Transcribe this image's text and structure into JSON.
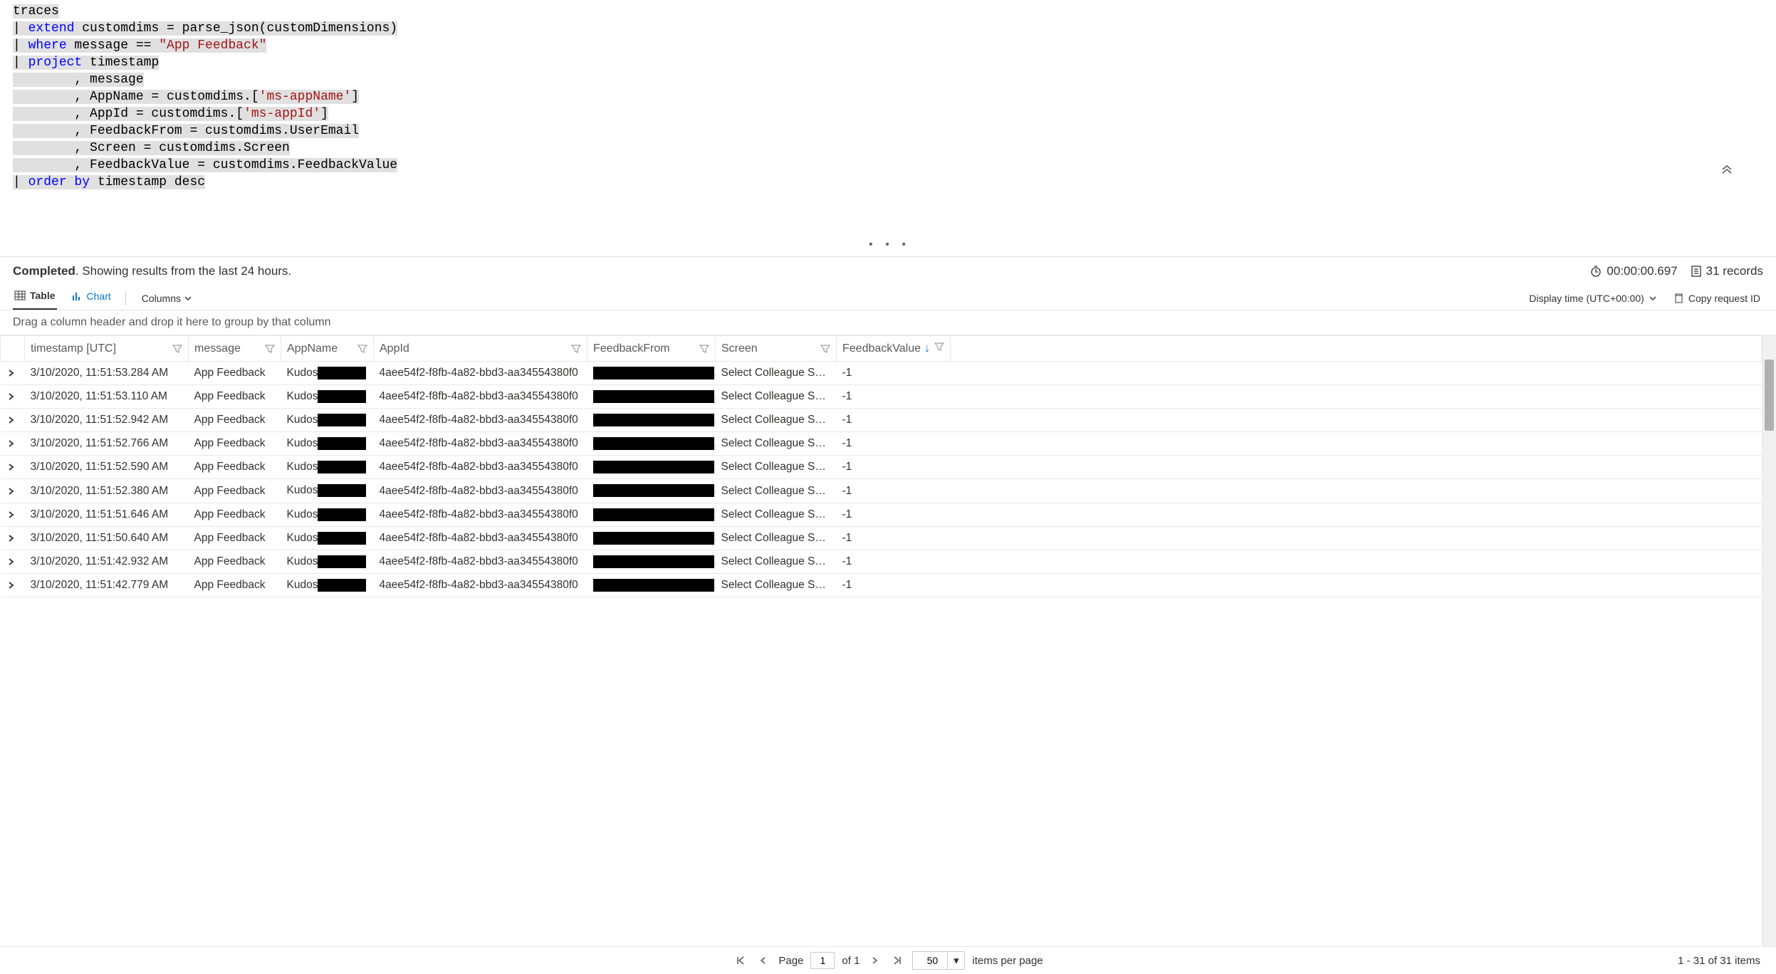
{
  "query": {
    "line1": "traces",
    "extend_kw": "extend",
    "extend_rest": " customdims = parse_json(customDimensions)",
    "where_kw": "where",
    "where_mid": " message == ",
    "where_str": "\"App Feedback\"",
    "project_kw": "project",
    "project_1": " timestamp",
    "project_2": "        , message",
    "project_3": "        , AppName = customdims.[",
    "project_3_str": "'ms-appName'",
    "project_3_end": "]",
    "project_4": "        , AppId = customdims.[",
    "project_4_str": "'ms-appId'",
    "project_4_end": "]",
    "project_5": "        , FeedbackFrom = customdims.UserEmail",
    "project_6": "        , Screen = customdims.Screen",
    "project_7": "        , FeedbackValue = customdims.FeedbackValue",
    "order_kw": "order by",
    "order_rest": " timestamp desc"
  },
  "status": {
    "completed": "Completed",
    "text": ". Showing results from the last 24 hours.",
    "duration": "00:00:00.697",
    "records": "31 records"
  },
  "tabs": {
    "table": "Table",
    "chart": "Chart",
    "columns": "Columns",
    "display_time": "Display time (UTC+00:00)",
    "copy_request": "Copy request ID"
  },
  "group_hint": "Drag a column header and drop it here to group by that column",
  "columns": {
    "timestamp": "timestamp [UTC]",
    "message": "message",
    "appname": "AppName",
    "appid": "AppId",
    "feedbackfrom": "FeedbackFrom",
    "screen": "Screen",
    "feedbackvalue": "FeedbackValue"
  },
  "rows": [
    {
      "ts": "3/10/2020, 11:51:53.284 AM",
      "msg": "App Feedback",
      "app": "Kudos",
      "id": "4aee54f2-f8fb-4a82-bbd3-aa34554380f0",
      "screen": "Select Colleague Screen",
      "fv": "-1"
    },
    {
      "ts": "3/10/2020, 11:51:53.110 AM",
      "msg": "App Feedback",
      "app": "Kudos",
      "id": "4aee54f2-f8fb-4a82-bbd3-aa34554380f0",
      "screen": "Select Colleague Screen",
      "fv": "-1"
    },
    {
      "ts": "3/10/2020, 11:51:52.942 AM",
      "msg": "App Feedback",
      "app": "Kudos",
      "id": "4aee54f2-f8fb-4a82-bbd3-aa34554380f0",
      "screen": "Select Colleague Screen",
      "fv": "-1"
    },
    {
      "ts": "3/10/2020, 11:51:52.766 AM",
      "msg": "App Feedback",
      "app": "Kudos",
      "id": "4aee54f2-f8fb-4a82-bbd3-aa34554380f0",
      "screen": "Select Colleague Screen",
      "fv": "-1"
    },
    {
      "ts": "3/10/2020, 11:51:52.590 AM",
      "msg": "App Feedback",
      "app": "Kudos",
      "id": "4aee54f2-f8fb-4a82-bbd3-aa34554380f0",
      "screen": "Select Colleague Screen",
      "fv": "-1"
    },
    {
      "ts": "3/10/2020, 11:51:52.380 AM",
      "msg": "App Feedback",
      "app": "Kudos",
      "id": "4aee54f2-f8fb-4a82-bbd3-aa34554380f0",
      "screen": "Select Colleague Screen",
      "fv": "-1"
    },
    {
      "ts": "3/10/2020, 11:51:51.646 AM",
      "msg": "App Feedback",
      "app": "Kudos",
      "id": "4aee54f2-f8fb-4a82-bbd3-aa34554380f0",
      "screen": "Select Colleague Screen",
      "fv": "-1"
    },
    {
      "ts": "3/10/2020, 11:51:50.640 AM",
      "msg": "App Feedback",
      "app": "Kudos",
      "id": "4aee54f2-f8fb-4a82-bbd3-aa34554380f0",
      "screen": "Select Colleague Screen",
      "fv": "-1"
    },
    {
      "ts": "3/10/2020, 11:51:42.932 AM",
      "msg": "App Feedback",
      "app": "Kudos",
      "id": "4aee54f2-f8fb-4a82-bbd3-aa34554380f0",
      "screen": "Select Colleague Screen",
      "fv": "-1"
    },
    {
      "ts": "3/10/2020, 11:51:42.779 AM",
      "msg": "App Feedback",
      "app": "Kudos",
      "id": "4aee54f2-f8fb-4a82-bbd3-aa34554380f0",
      "screen": "Select Colleague Screen",
      "fv": "-1"
    }
  ],
  "pager": {
    "page_label": "Page",
    "page": "1",
    "of": "of 1",
    "size": "50",
    "items_label": "items per page",
    "summary": "1 - 31 of 31 items"
  }
}
